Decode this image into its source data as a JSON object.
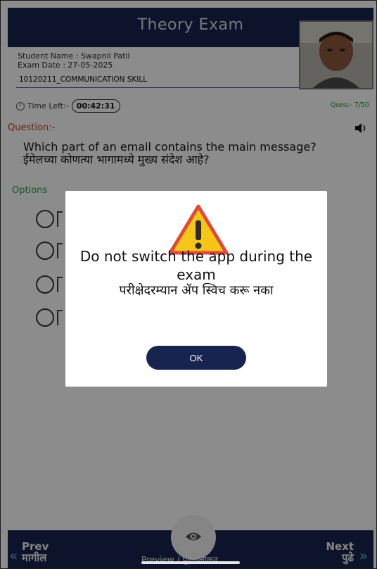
{
  "header": {
    "title": "Theory Exam"
  },
  "student": {
    "name_line": "Student Name : Swapnil Patil",
    "date_line": "Exam Date : 27-05-2025",
    "course_line": "10120211_COMMUNICATION SKILL"
  },
  "timer": {
    "label": "Time Left:-",
    "value": "00:42:31"
  },
  "progress": {
    "label": "Ques:- 7/50"
  },
  "question": {
    "label": "Question:-",
    "text_en": "Which part of an email contains the main message?",
    "text_mr": "ईमेलच्या कोणत्या भागामध्ये मुख्य संदेश आहे?"
  },
  "options": {
    "label": "Options"
  },
  "modal": {
    "message_en": "Do not switch the app during the exam",
    "message_mr": "परीक्षेदरम्यान ॲप स्विच करू नका",
    "ok_label": "OK"
  },
  "footer": {
    "prev_en": "Prev",
    "prev_mr": "मागील",
    "next_en": "Next",
    "next_mr": "पुढे",
    "preview_label": "Preview / पूर्वावलोकन"
  },
  "colors": {
    "primary": "#17244f",
    "question_label": "#c0392b",
    "options_label": "#1d9b3a",
    "warning": "#f5c518"
  },
  "icons": {
    "clock": "clock-icon",
    "speaker": "speaker-icon",
    "warning": "warning-triangle-icon",
    "eye": "eye-icon",
    "chevron_left": "chevron-left-icon",
    "chevron_right": "chevron-right-icon"
  }
}
